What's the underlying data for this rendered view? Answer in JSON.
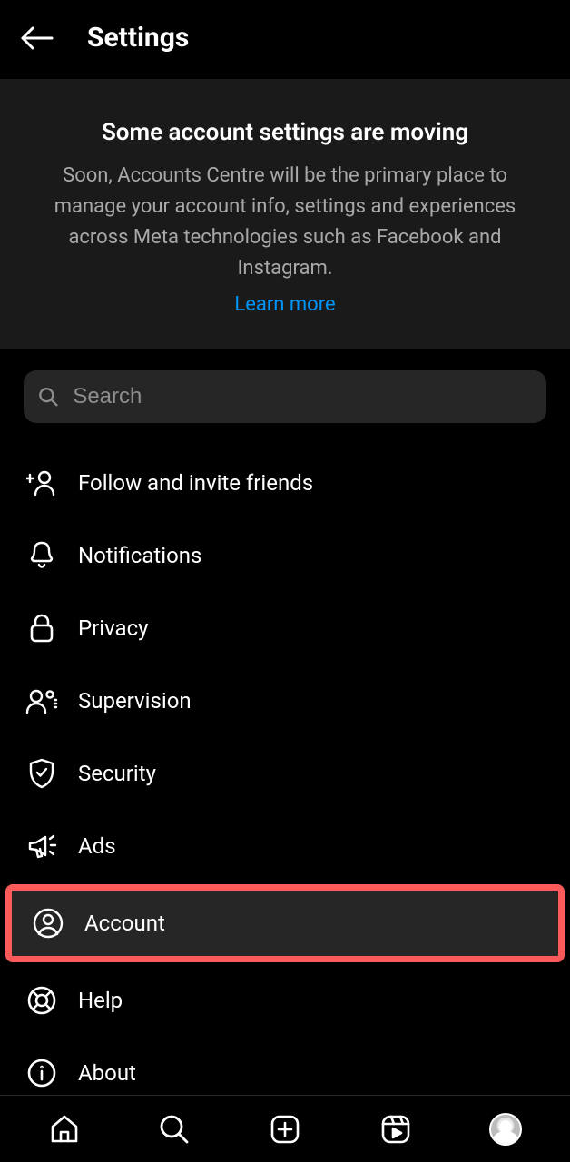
{
  "header": {
    "title": "Settings"
  },
  "banner": {
    "title": "Some account settings are moving",
    "body": "Soon, Accounts Centre will be the primary place to manage your account info, settings and experiences across Meta technologies such as Facebook and Instagram.",
    "link": "Learn more"
  },
  "search": {
    "placeholder": "Search"
  },
  "menu": {
    "items": [
      {
        "label": "Follow and invite friends"
      },
      {
        "label": "Notifications"
      },
      {
        "label": "Privacy"
      },
      {
        "label": "Supervision"
      },
      {
        "label": "Security"
      },
      {
        "label": "Ads"
      },
      {
        "label": "Account"
      },
      {
        "label": "Help"
      },
      {
        "label": "About"
      }
    ]
  },
  "highlight_index": 6
}
